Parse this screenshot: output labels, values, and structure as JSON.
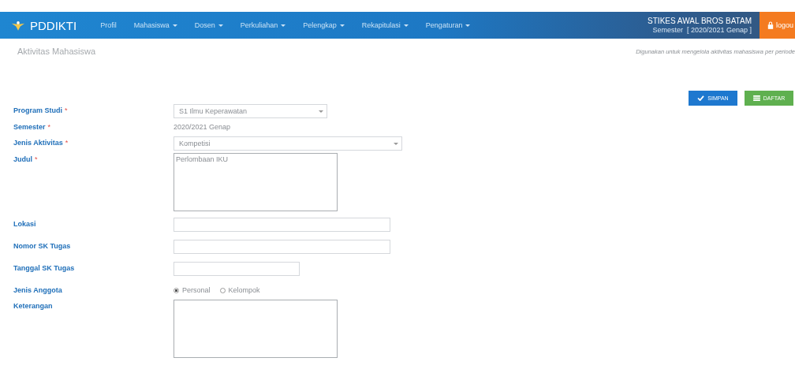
{
  "navbar": {
    "brand": "PDDIKTI",
    "menu": [
      {
        "label": "Profil",
        "dropdown": false
      },
      {
        "label": "Mahasiswa",
        "dropdown": true
      },
      {
        "label": "Dosen",
        "dropdown": true
      },
      {
        "label": "Perkuliahan",
        "dropdown": true
      },
      {
        "label": "Pelengkap",
        "dropdown": true
      },
      {
        "label": "Rekapitulasi",
        "dropdown": true
      },
      {
        "label": "Pengaturan",
        "dropdown": true
      }
    ],
    "institution": "STIKES AWAL BROS BATAM",
    "semester": "Semester  [ 2020/2021 Genap ]",
    "logout": "logou"
  },
  "page": {
    "title": "Aktivitas Mahasiswa",
    "description": "Digunakan untuk mengelola aktivitas mahasiswa per periode"
  },
  "buttons": [
    {
      "kind": "save",
      "label": "SIMPAN"
    },
    {
      "kind": "list",
      "label": "DAFTAR"
    }
  ],
  "form": [
    {
      "kind": "select",
      "label": "Program Studi",
      "required_mark": "*",
      "value": "S1 Ilmu Keperawatan"
    },
    {
      "kind": "static",
      "label": "Semester",
      "required_mark": "*",
      "value": "2020/2021 Genap"
    },
    {
      "kind": "select",
      "label": "Jenis Aktivitas",
      "required_mark": "*",
      "value": "Kompetisi"
    },
    {
      "kind": "textarea",
      "label": "Judul",
      "required_mark": "*",
      "value": "Perlombaan IKU"
    },
    {
      "kind": "input",
      "label": "Lokasi"
    },
    {
      "kind": "input",
      "label": "Nomor SK Tugas"
    },
    {
      "kind": "input",
      "label": "Tanggal SK Tugas"
    },
    {
      "kind": "radio",
      "label": "Jenis Anggota",
      "options": [
        {
          "label": "Personal",
          "selected": true
        },
        {
          "label": "Kelompok",
          "selected": false
        }
      ]
    },
    {
      "kind": "textarea",
      "label": "Keterangan"
    }
  ]
}
